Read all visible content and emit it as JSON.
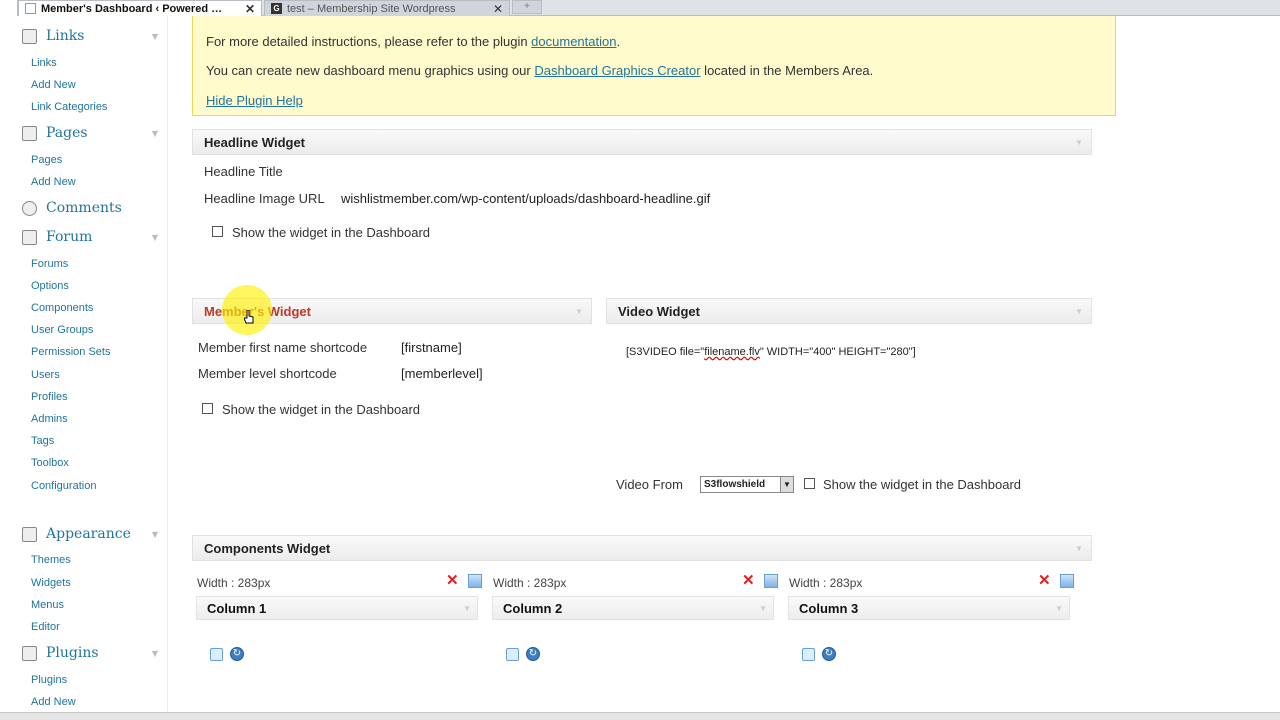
{
  "browser": {
    "active_tab": "Member's Dashboard ‹ Powered …",
    "inactive_tab": "test – Membership Site Wordpress",
    "inactive_tab_favicon": "G",
    "close_glyph": "✕"
  },
  "sidebar": {
    "links": {
      "label": "Links",
      "items": [
        "Links",
        "Add New",
        "Link Categories"
      ]
    },
    "pages": {
      "label": "Pages",
      "items": [
        "Pages",
        "Add New"
      ]
    },
    "comments": {
      "label": "Comments"
    },
    "forum": {
      "label": "Forum",
      "items": [
        "Forums",
        "Options",
        "Components",
        "User Groups",
        "Permission Sets",
        "Users",
        "Profiles",
        "Admins",
        "Tags",
        "Toolbox",
        "Configuration"
      ]
    },
    "appearance": {
      "label": "Appearance",
      "items": [
        "Themes",
        "Widgets",
        "Menus",
        "Editor"
      ]
    },
    "plugins": {
      "label": "Plugins",
      "items": [
        "Plugins",
        "Add New"
      ]
    }
  },
  "notice": {
    "line1_prefix": "For more detailed instructions, please refer to the plugin ",
    "line1_link": "documentation",
    "line1_suffix": ".",
    "line2_prefix": "You can create new dashboard menu graphics using our ",
    "line2_link": "Dashboard Graphics Creator",
    "line2_suffix": " located in the Members Area.",
    "hide_link": "Hide Plugin Help"
  },
  "headline_widget": {
    "title": "Headline Widget",
    "title_label": "Headline Title",
    "image_label": "Headline Image URL",
    "image_value": "wishlistmember.com/wp-content/uploads/dashboard-headline.gif",
    "show_label": "Show the widget in the Dashboard"
  },
  "members_widget": {
    "title": "Member's Widget",
    "first_name_label": "Member first name shortcode",
    "first_name_value": "[firstname]",
    "level_label": "Member level shortcode",
    "level_value": "[memberlevel]",
    "show_label": "Show the widget in the Dashboard"
  },
  "video_widget": {
    "title": "Video Widget",
    "shortcode_prefix": "[S3VIDEO file=\"",
    "shortcode_file": "filename.flv",
    "shortcode_suffix": "\" WIDTH=\"400\" HEIGHT=\"280\"]",
    "video_from_label": "Video From",
    "video_from_value": "S3flowshield",
    "show_label": "Show the widget in the Dashboard"
  },
  "components_widget": {
    "title": "Components Widget",
    "columns": [
      {
        "width": "Width : 283px",
        "title": "Column 1"
      },
      {
        "width": "Width : 283px",
        "title": "Column 2"
      },
      {
        "width": "Width : 283px",
        "title": "Column 3"
      }
    ]
  },
  "colors": {
    "link": "#21759b",
    "notice_bg": "#fffbcc",
    "highlight": "#fff000",
    "delete": "#e02020"
  }
}
